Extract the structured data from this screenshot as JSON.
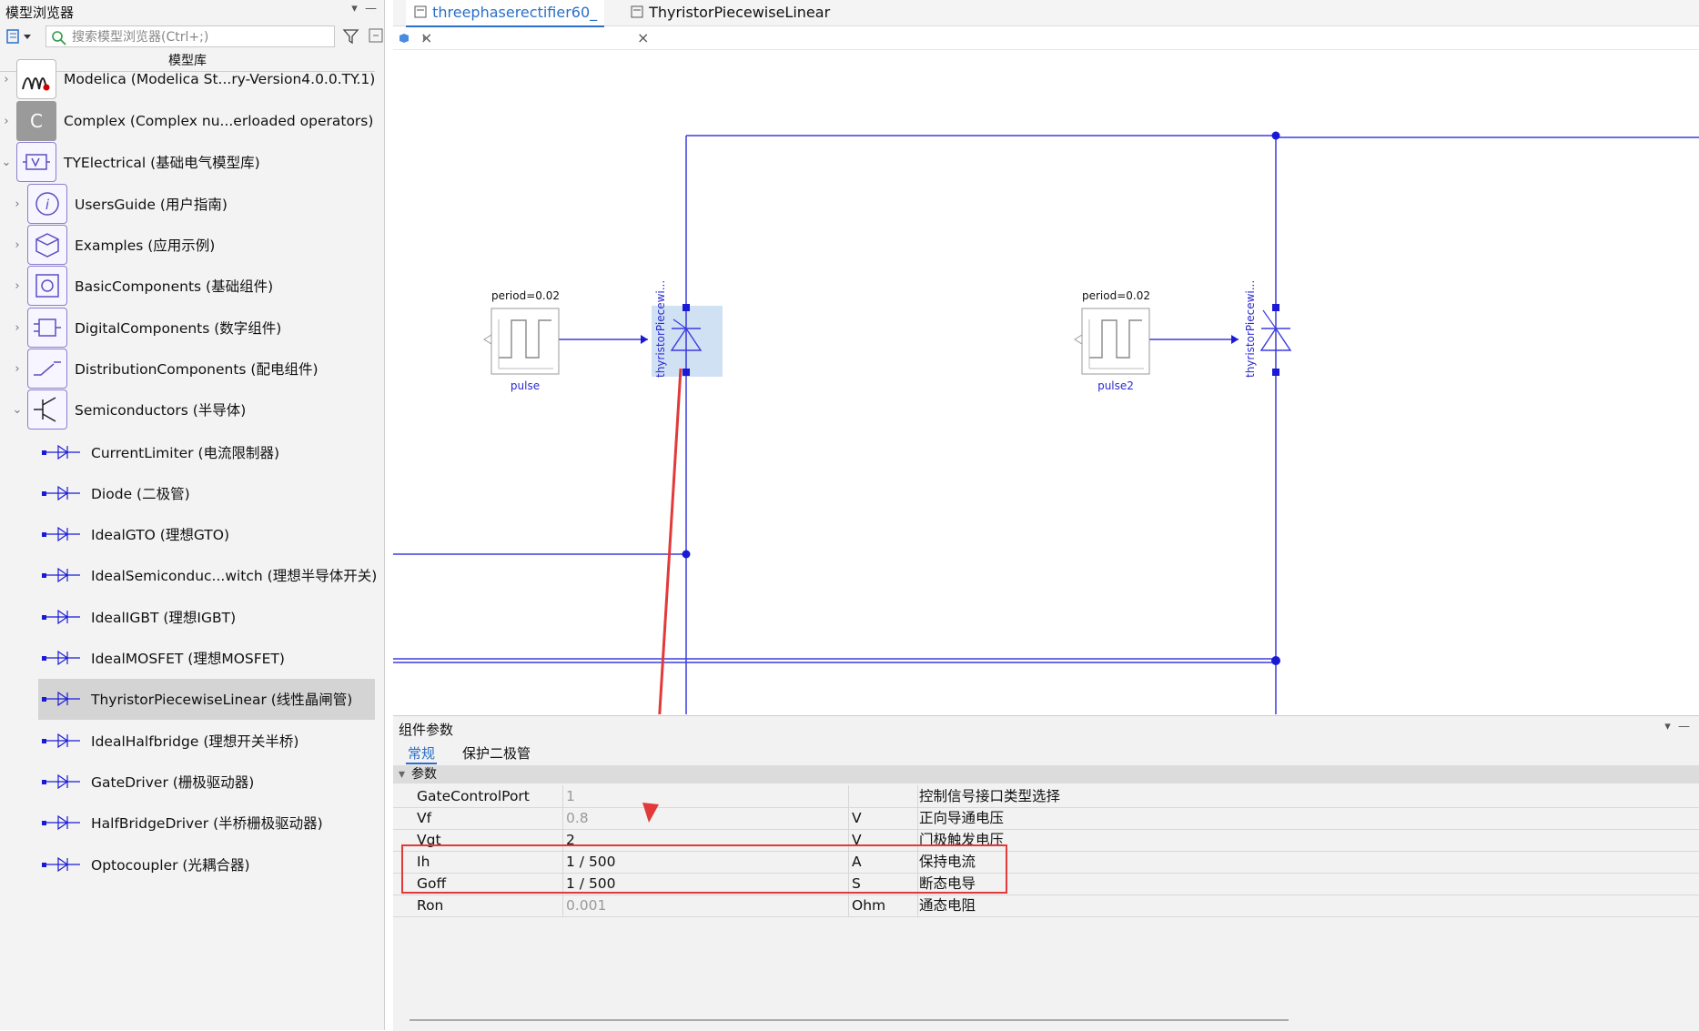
{
  "browser": {
    "title": "模型浏览器",
    "search_placeholder": "搜索模型浏览器(Ctrl+;)",
    "library_header": "模型库",
    "items": [
      {
        "label": "Modelica (Modelica St...ry-Version4.0.0.TY.1)",
        "icon": "modelica-logo-icon",
        "expanded": false
      },
      {
        "label": "Complex (Complex nu...erloaded operators)",
        "icon": "complex-c-icon",
        "expanded": false
      },
      {
        "label": "TYElectrical (基础电气模型库)",
        "icon": "tyelectrical-icon",
        "expanded": true
      },
      {
        "label": "UsersGuide (用户指南)",
        "icon": "info-icon",
        "expanded": false
      },
      {
        "label": "Examples (应用示例)",
        "icon": "cube-icon",
        "expanded": false
      },
      {
        "label": "BasicComponents (基础组件)",
        "icon": "circle-square-icon",
        "expanded": false
      },
      {
        "label": "DigitalComponents (数字组件)",
        "icon": "digital-icon",
        "expanded": false
      },
      {
        "label": "DistributionComponents (配电组件)",
        "icon": "switch-icon",
        "expanded": false
      },
      {
        "label": "Semiconductors (半导体)",
        "icon": "transistor-icon",
        "expanded": true
      }
    ],
    "leaves": [
      {
        "label": "CurrentLimiter (电流限制器)",
        "icon": "current-limiter-icon"
      },
      {
        "label": "Diode (二极管)",
        "icon": "diode-icon"
      },
      {
        "label": "IdealGTO (理想GTO)",
        "icon": "gto-icon"
      },
      {
        "label": "IdealSemiconduc...witch (理想半导体开关)",
        "icon": "semiconductor-switch-icon"
      },
      {
        "label": "IdealIGBT (理想IGBT)",
        "icon": "igbt-icon"
      },
      {
        "label": "IdealMOSFET (理想MOSFET)",
        "icon": "mosfet-icon"
      },
      {
        "label": "ThyristorPiecewiseLinear (线性晶闸管)",
        "icon": "thyristor-icon",
        "selected": true
      },
      {
        "label": "IdealHalfbridge (理想开关半桥)",
        "icon": "halfbridge-icon"
      },
      {
        "label": "GateDriver (栅极驱动器)",
        "icon": "gate-driver-icon"
      },
      {
        "label": "HalfBridgeDriver (半桥栅极驱动器)",
        "icon": "halfbridge-driver-icon"
      },
      {
        "label": "Optocoupler (光耦合器)",
        "icon": "optocoupler-icon"
      }
    ]
  },
  "tabs": [
    {
      "label": "threephaserectifier60_",
      "active": true
    },
    {
      "label": "ThyristorPiecewiseLinear",
      "active": false
    }
  ],
  "diagram": {
    "pulse1": {
      "param": "period=0.02",
      "name": "pulse"
    },
    "pulse2": {
      "param": "period=0.02",
      "name": "pulse2"
    },
    "thyristor1": {
      "name": "thyristorPiecewi..."
    },
    "thyristor2": {
      "name": "thyristorPiecewi..."
    }
  },
  "params_panel": {
    "title": "组件参数",
    "tabs": [
      "常规",
      "保护二极管"
    ],
    "group": "参数",
    "rows": [
      {
        "name": "GateControlPort",
        "value": "1",
        "unit": "",
        "desc": "控制信号接口类型选择",
        "dim": true
      },
      {
        "name": "Vf",
        "value": "0.8",
        "unit": "V",
        "desc": "正向导通电压",
        "dim": true
      },
      {
        "name": "Vgt",
        "value": "2",
        "unit": "V",
        "desc": "门极触发电压",
        "dim": false
      },
      {
        "name": "Ih",
        "value": "1 / 500",
        "unit": "A",
        "desc": "保持电流",
        "dim": false
      },
      {
        "name": "Goff",
        "value": "1 / 500",
        "unit": "S",
        "desc": "断态电导",
        "dim": false
      },
      {
        "name": "Ron",
        "value": "0.001",
        "unit": "Ohm",
        "desc": "通态电阻",
        "dim": true
      }
    ]
  },
  "colors": {
    "wire": "#3b3bdf",
    "accent": "#2a6fc9",
    "annotation": "#e23a3a"
  }
}
